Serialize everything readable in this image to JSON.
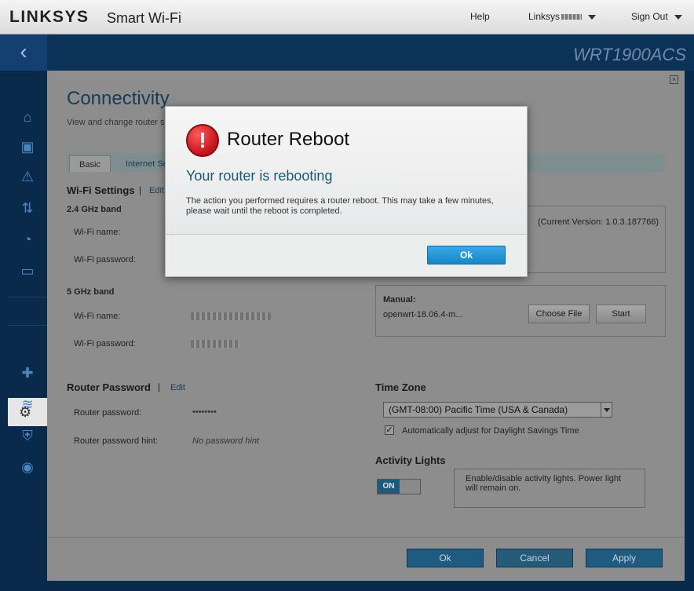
{
  "header": {
    "brand": "LINKSYS",
    "product": "Smart Wi-Fi",
    "help": "Help",
    "user": "Linksys",
    "sign_out": "Sign Out",
    "model": "WRT1900ACS",
    "back_glyph": "‹"
  },
  "sidebar": {
    "icons": [
      "network-map-icon",
      "devices-icon",
      "warning-icon",
      "media-icon",
      "speed-test-icon",
      "external-storage-icon",
      "connectivity-icon",
      "troubleshooting-icon",
      "wireless-icon",
      "security-icon",
      "openvpn-icon"
    ]
  },
  "page": {
    "title": "Connectivity",
    "subtitle": "View and change router se",
    "tabs": [
      "Basic",
      "Internet Se"
    ]
  },
  "wifi": {
    "title": "Wi-Fi Settings",
    "edit": "Edit",
    "band24": "2.4 GHz band",
    "band5": "5 GHz band",
    "name_label": "Wi-Fi name:",
    "password_label": "Wi-Fi password:"
  },
  "firmware": {
    "current_version": "(Current Version: 1.0.3.187766)",
    "manual_label": "Manual:",
    "file_name": "openwrt-18.06.4-m...",
    "choose_file": "Choose File",
    "start": "Start"
  },
  "router_password": {
    "title": "Router Password",
    "edit": "Edit",
    "password_label": "Router password:",
    "password_value": "••••••••",
    "hint_label": "Router password hint:",
    "hint_value": "No password hint"
  },
  "time_zone": {
    "title": "Time Zone",
    "selected": "(GMT-08:00) Pacific Time (USA & Canada)",
    "dst_checked": true,
    "dst_label": "Automatically adjust for Daylight Savings Time"
  },
  "activity_lights": {
    "title": "Activity Lights",
    "toggle": "ON",
    "note": "Enable/disable activity lights. Power light will remain on."
  },
  "footer": {
    "ok": "Ok",
    "cancel": "Cancel",
    "apply": "Apply"
  },
  "modal": {
    "title": "Router Reboot",
    "subtitle": "Your router is rebooting",
    "body": "The action you performed requires a router reboot. This may take a few minutes, please wait until the reboot is completed.",
    "ok": "Ok"
  }
}
